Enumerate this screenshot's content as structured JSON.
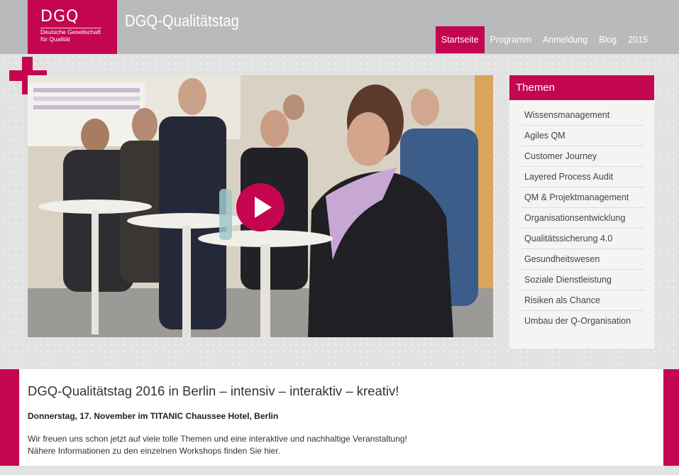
{
  "header": {
    "logo_mark": "DGQ",
    "logo_line1": "Deutsche Gesellschaft",
    "logo_line2": "für Qualität",
    "site_title": "DGQ-Qualitätstag",
    "nav": [
      {
        "label": "Startseite",
        "active": true
      },
      {
        "label": "Programm",
        "active": false
      },
      {
        "label": "Anmeldung",
        "active": false
      },
      {
        "label": "Blog",
        "active": false
      },
      {
        "label": "2015",
        "active": false
      }
    ]
  },
  "video": {
    "play_icon": "play-icon"
  },
  "sidebar": {
    "title": "Themen",
    "items": [
      {
        "label": "Wissensmanagement"
      },
      {
        "label": "Agiles QM"
      },
      {
        "label": "Customer Journey"
      },
      {
        "label": "Layered Process Audit"
      },
      {
        "label": "QM & Projektmanagement"
      },
      {
        "label": "Organisationsentwicklung"
      },
      {
        "label": "Qualitätssicherung 4.0"
      },
      {
        "label": "Gesundheitswesen"
      },
      {
        "label": "Soziale Dienstleistung"
      },
      {
        "label": "Risiken als Chance"
      },
      {
        "label": "Umbau der Q-Organisation"
      }
    ]
  },
  "content": {
    "title": "DGQ-Qualitätstag 2016 in Berlin – intensiv – interaktiv – kreativ!",
    "date": "Donnerstag, 17. November im TITANIC Chaussee Hotel, Berlin",
    "text_line1": "Wir freuen uns schon jetzt auf viele tolle Themen und eine interaktive und nachhaltige Veranstaltung!",
    "text_line2": "Nähere Informationen zu den einzelnen Workshops finden Sie hier."
  },
  "colors": {
    "brand": "#c4054f",
    "header_bg": "#b9babb",
    "page_bg": "#e2e2e3"
  }
}
